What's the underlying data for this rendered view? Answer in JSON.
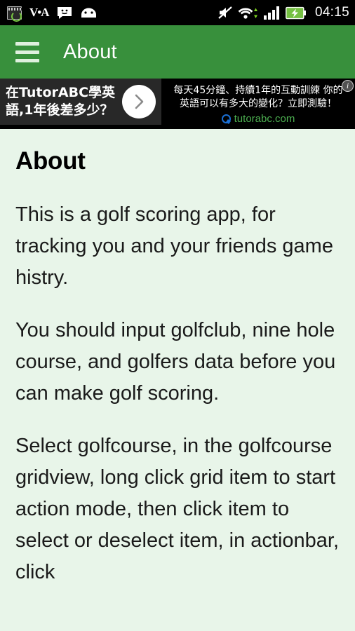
{
  "statusbar": {
    "time": "04:15",
    "left_icons": [
      {
        "name": "screenshot-app-icon",
        "glyph": ""
      },
      {
        "name": "voa-news-icon",
        "glyph": "V•A"
      },
      {
        "name": "messaging-icon",
        "glyph": ""
      },
      {
        "name": "android-system-icon",
        "glyph": ""
      }
    ],
    "right_icons": [
      {
        "name": "silent-mode-icon",
        "label": "mute"
      },
      {
        "name": "wifi-icon",
        "label": "wifi"
      },
      {
        "name": "signal-bars-icon",
        "label": "signal"
      },
      {
        "name": "battery-charging-icon",
        "label": "charging"
      }
    ]
  },
  "actionbar": {
    "menu_label": "menu",
    "title": "About"
  },
  "ad": {
    "left_text_line1": "在TutorABC學英",
    "left_text_line2": "語,1年後差多少？",
    "arrow_label": "next",
    "right_line1": "每天45分鐘、持續1年的互動訓練 你的",
    "right_line2": "英語可以有多大的變化？立即測驗！",
    "url": "tutorabc.com",
    "info_label": "i"
  },
  "content": {
    "title": "About",
    "paragraphs": [
      "This is a golf scoring app, for tracking you and your friends game histry.",
      "You should input golfclub, nine hole course, and golfers data before you can make golf scoring.",
      "Select golfcourse, in the golfcourse gridview, long click grid item to start action mode, then click item to select or deselect item, in actionbar, click"
    ]
  },
  "colors": {
    "accent_green": "#38903c",
    "content_bg": "#e8f5e9",
    "status_bg": "#000000",
    "ad_left_bg": "#282828",
    "ad_url_green": "#4caf50"
  }
}
